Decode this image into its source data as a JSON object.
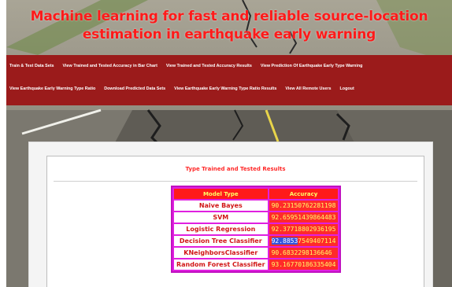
{
  "header": {
    "title": "Machine learning for fast and reliable source-location estimation in earthquake early warning"
  },
  "nav": {
    "row1": [
      "Train & Test Data Sets",
      "View Trained and Tested Accuracy in Bar Chart",
      "View Trained and Tested Accuracy Results",
      "View Prediction Of Earthquake Early Type Warning"
    ],
    "row2": [
      "View Earthquake Early Warning Type Ratio",
      "Download Predicted Data Sets",
      "View Earthquake Early Warning Type Ratio Results",
      "View All Remote Users",
      "Logout"
    ]
  },
  "results": {
    "title": "Type Trained and Tested Results",
    "columns": [
      "Model Type",
      "Accuracy"
    ],
    "rows": [
      {
        "model": "Naive Bayes",
        "accuracy": "90.23150762281198"
      },
      {
        "model": "SVM",
        "accuracy": "92.65951439864483"
      },
      {
        "model": "Logistic Regression",
        "accuracy": "92.37718802936195"
      },
      {
        "model": "Decision Tree Classifier",
        "accuracy_selected": "92.8853",
        "accuracy_rest": "7549407114"
      },
      {
        "model": "KNeighborsClassifier",
        "accuracy": "90.6832298136646"
      },
      {
        "model": "Random Forest Classifier",
        "accuracy": "93.16770186335404"
      }
    ]
  },
  "colors": {
    "title_red": "#ff1a1a",
    "nav_bg": "#9b1b1b",
    "table_border": "#e020e0",
    "cell_red": "#ff2a2a",
    "cell_text_yellow": "#ffff66",
    "selection_blue": "#3355dd"
  }
}
